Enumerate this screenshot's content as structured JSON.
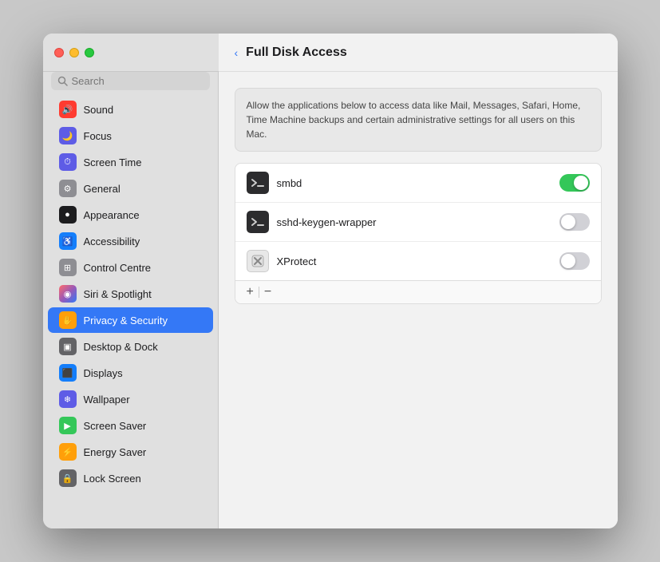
{
  "window": {
    "title": "Full Disk Access"
  },
  "trafficLights": {
    "red": "close",
    "yellow": "minimize",
    "green": "maximize"
  },
  "sidebar": {
    "search_placeholder": "Search",
    "items": [
      {
        "id": "sound",
        "label": "Sound",
        "icon": "🔊",
        "iconClass": "icon-sound",
        "active": false
      },
      {
        "id": "focus",
        "label": "Focus",
        "icon": "🌙",
        "iconClass": "icon-focus",
        "active": false
      },
      {
        "id": "screen-time",
        "label": "Screen Time",
        "icon": "⏱",
        "iconClass": "icon-screentime",
        "active": false
      },
      {
        "id": "general",
        "label": "General",
        "icon": "⚙",
        "iconClass": "icon-general",
        "active": false
      },
      {
        "id": "appearance",
        "label": "Appearance",
        "icon": "●",
        "iconClass": "icon-appearance",
        "active": false
      },
      {
        "id": "accessibility",
        "label": "Accessibility",
        "icon": "♿",
        "iconClass": "icon-accessibility",
        "active": false
      },
      {
        "id": "control-centre",
        "label": "Control Centre",
        "icon": "⊞",
        "iconClass": "icon-controlcentre",
        "active": false
      },
      {
        "id": "siri-spotlight",
        "label": "Siri & Spotlight",
        "icon": "◉",
        "iconClass": "icon-siri",
        "active": false
      },
      {
        "id": "privacy-security",
        "label": "Privacy & Security",
        "icon": "✋",
        "iconClass": "icon-privacy",
        "active": true
      },
      {
        "id": "desktop-dock",
        "label": "Desktop & Dock",
        "icon": "▣",
        "iconClass": "icon-desktop",
        "active": false
      },
      {
        "id": "displays",
        "label": "Displays",
        "icon": "⬛",
        "iconClass": "icon-displays",
        "active": false
      },
      {
        "id": "wallpaper",
        "label": "Wallpaper",
        "icon": "❄",
        "iconClass": "icon-wallpaper",
        "active": false
      },
      {
        "id": "screen-saver",
        "label": "Screen Saver",
        "icon": "▶",
        "iconClass": "icon-screensaver",
        "active": false
      },
      {
        "id": "energy-saver",
        "label": "Energy Saver",
        "icon": "⚡",
        "iconClass": "icon-energysaver",
        "active": false
      },
      {
        "id": "lock-screen",
        "label": "Lock Screen",
        "icon": "🔒",
        "iconClass": "icon-lockscreen",
        "active": false
      }
    ]
  },
  "main": {
    "back_label": "‹",
    "title": "Full Disk Access",
    "description": "Allow the applications below to access data like Mail, Messages, Safari, Home, Time Machine backups and certain administrative settings for all users on this Mac.",
    "apps": [
      {
        "name": "smbd",
        "iconLight": false,
        "iconText": "■",
        "enabled": true
      },
      {
        "name": "sshd-keygen-wrapper",
        "iconLight": false,
        "iconText": "■",
        "enabled": false
      },
      {
        "name": "XProtect",
        "iconLight": true,
        "iconText": "✗",
        "enabled": false
      }
    ],
    "add_label": "+",
    "remove_label": "−"
  }
}
